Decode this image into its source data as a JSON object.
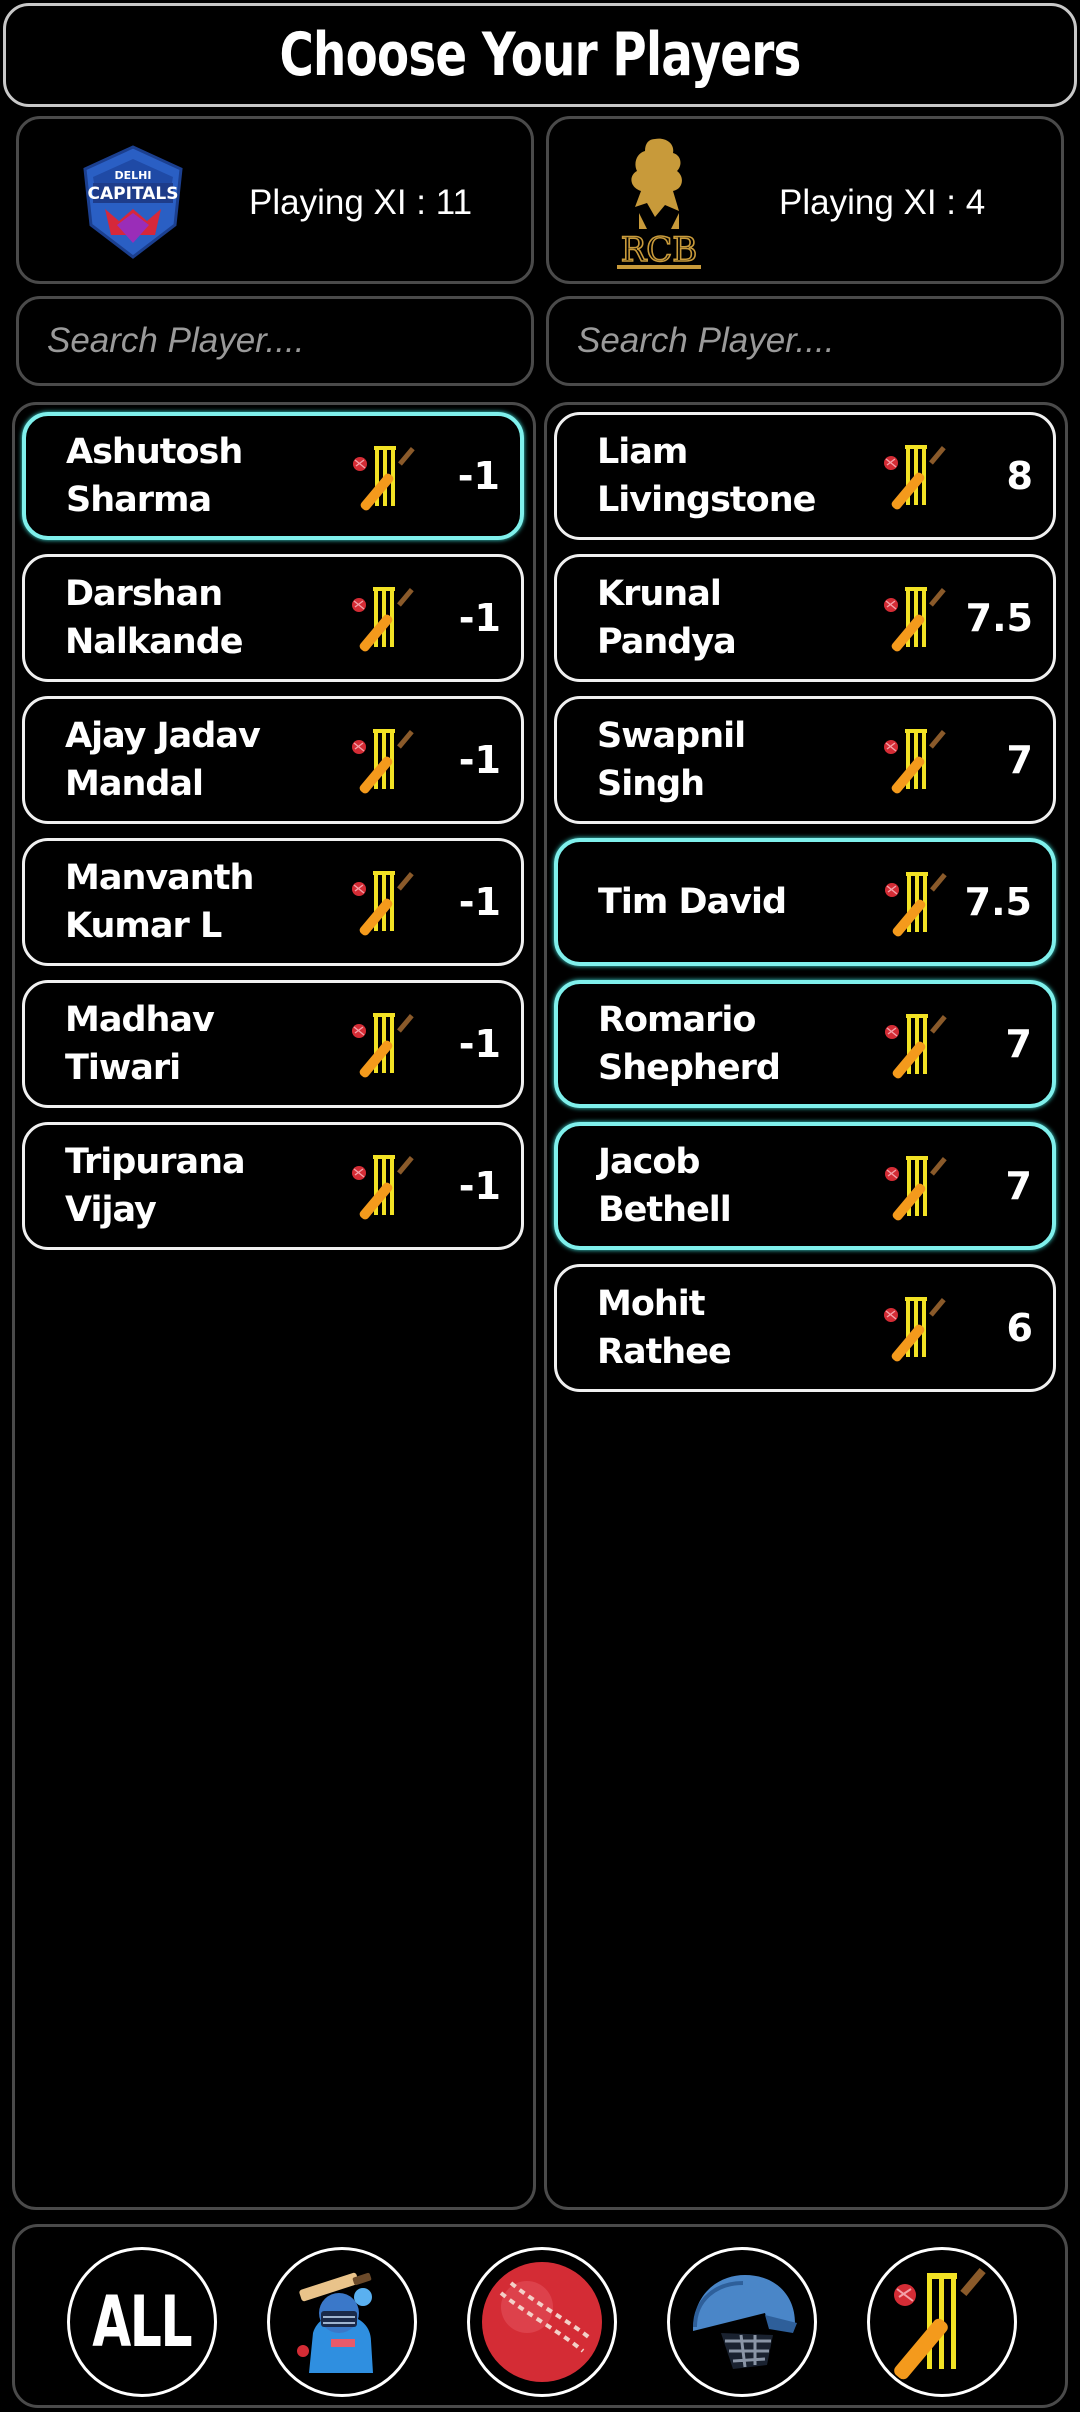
{
  "page": {
    "title": "Choose Your Players"
  },
  "teams": [
    {
      "name": "Delhi Capitals",
      "logo_icon": "delhi-capitals-logo",
      "playing_xi_label": "Playing XI : 11",
      "search_placeholder": "Search Player....",
      "players": [
        {
          "first": "Ashutosh",
          "last": "Sharma",
          "points": "-1",
          "role_icon": "wicketkeeper-icon",
          "selected": true
        },
        {
          "first": "Darshan",
          "last": "Nalkande",
          "points": "-1",
          "role_icon": "wicketkeeper-icon",
          "selected": false
        },
        {
          "first": "Ajay Jadav",
          "last": "Mandal",
          "points": "-1",
          "role_icon": "wicketkeeper-icon",
          "selected": false
        },
        {
          "first": "Manvanth",
          "last": "Kumar L",
          "points": "-1",
          "role_icon": "wicketkeeper-icon",
          "selected": false
        },
        {
          "first": "Madhav",
          "last": "Tiwari",
          "points": "-1",
          "role_icon": "wicketkeeper-icon",
          "selected": false
        },
        {
          "first": "Tripurana",
          "last": "Vijay",
          "points": "-1",
          "role_icon": "wicketkeeper-icon",
          "selected": false
        }
      ]
    },
    {
      "name": "Royal Challengers Bengaluru",
      "logo_icon": "rcb-logo",
      "playing_xi_label": "Playing XI : 4",
      "search_placeholder": "Search Player....",
      "players": [
        {
          "first": "Liam",
          "last": "Livingstone",
          "points": "8",
          "role_icon": "wicketkeeper-icon",
          "selected": false
        },
        {
          "first": "Krunal",
          "last": "Pandya",
          "points": "7.5",
          "role_icon": "wicketkeeper-icon",
          "selected": false
        },
        {
          "first": "Swapnil",
          "last": "Singh",
          "points": "7",
          "role_icon": "wicketkeeper-icon",
          "selected": false
        },
        {
          "first": "Tim David",
          "last": "",
          "points": "7.5",
          "role_icon": "wicketkeeper-icon",
          "selected": true
        },
        {
          "first": "Romario",
          "last": "Shepherd",
          "points": "7",
          "role_icon": "wicketkeeper-icon",
          "selected": true
        },
        {
          "first": "Jacob",
          "last": "Bethell",
          "points": "7",
          "role_icon": "wicketkeeper-icon",
          "selected": true
        },
        {
          "first": "Mohit",
          "last": "Rathee",
          "points": "6",
          "role_icon": "wicketkeeper-icon",
          "selected": false
        }
      ]
    }
  ],
  "filters": [
    {
      "label": "ALL",
      "icon": "all-filter"
    },
    {
      "label": "",
      "icon": "batsman-icon"
    },
    {
      "label": "",
      "icon": "cricket-ball-icon"
    },
    {
      "label": "",
      "icon": "helmet-icon"
    },
    {
      "label": "",
      "icon": "wicketkeeper-icon"
    }
  ],
  "colors": {
    "background": "#000000",
    "card_border": "#4a4a4a",
    "row_border": "#f0f0f0",
    "selected_border": "#7ff0ec",
    "bat_orange": "#f49a1c",
    "stump_yellow": "#f2e224",
    "ball_red": "#d42c35"
  }
}
